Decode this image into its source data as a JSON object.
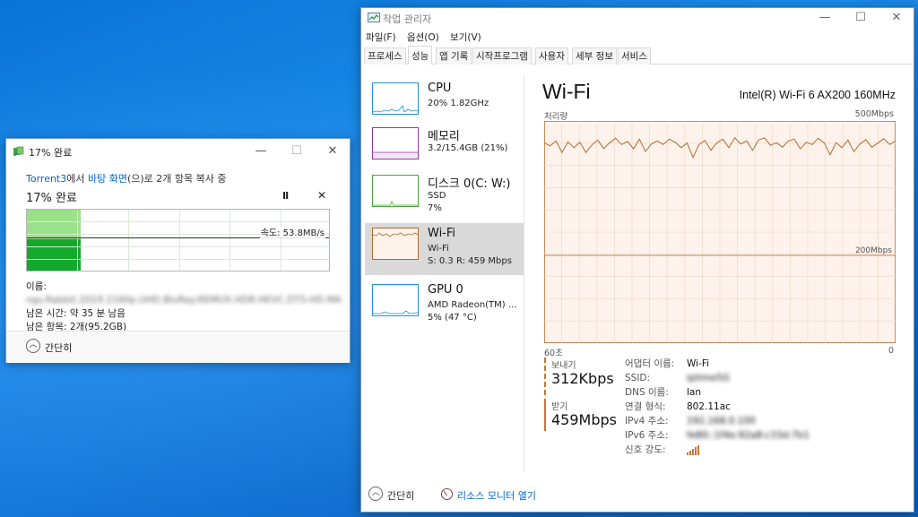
{
  "copy_dialog": {
    "title": "17% 완료",
    "source_name": "Torrent3",
    "source_mid": "에서",
    "dest_name": "바탕 화면",
    "source_tail": "(으)로 2개 항목 복사 중",
    "percent_label": "17% 완료",
    "pause_label": "II",
    "cancel_label": "✕",
    "progress_fraction": 0.17,
    "speed_label": "속도: 53.8MB/s",
    "name_label": "이름:",
    "name_value": "ngv.Rabbit.2019.2160p.UHD.BluRay.REMUX.HDR.HEVC.DTS-HD.MA",
    "time_left": "남은 시간: 약 35 분 남음",
    "items_left": "남은 항목: 2개(95.2GB)",
    "collapse_label": "간단히",
    "minimize": "—",
    "maximize": "☐",
    "close": "✕"
  },
  "task_manager": {
    "title": "작업 관리자",
    "minimize": "—",
    "maximize": "☐",
    "close": "✕",
    "menu": [
      "파일(F)",
      "옵션(O)",
      "보기(V)"
    ],
    "tabs": [
      "프로세스",
      "성능",
      "앱 기록",
      "시작프로그램",
      "사용자",
      "세부 정보",
      "서비스"
    ],
    "active_tab": 1,
    "sidebar": [
      {
        "name": "CPU",
        "line2": "20% 1.82GHz",
        "line3": "",
        "color": "#1f8fd8"
      },
      {
        "name": "메모리",
        "line2": "3.2/15.4GB (21%)",
        "line3": "",
        "color": "#8e3aa6"
      },
      {
        "name": "디스크 0(C: W:)",
        "line2": "SSD",
        "line3": "7%",
        "color": "#4aa33a"
      },
      {
        "name": "Wi-Fi",
        "line2": "Wi-Fi",
        "line3": "S: 0.3  R: 459 Mbps",
        "color": "#b1692a"
      },
      {
        "name": "GPU 0",
        "line2": "AMD Radeon(TM) ...",
        "line3": "5% (47 °C)",
        "color": "#1f8fd8"
      }
    ],
    "active_item": 3,
    "perf": {
      "title": "Wi-Fi",
      "device": "Intel(R) Wi-Fi 6 AX200 160MHz",
      "y_label": "처리량",
      "y_max_label": "500Mbps",
      "mid_label": "200Mbps",
      "x_left": "60초",
      "x_right": "0"
    },
    "send_label": "보내기",
    "send_value": "312Kbps",
    "recv_label": "받기",
    "recv_value": "459Mbps",
    "details": [
      {
        "k": "어댑터 이름:",
        "v": "Wi-Fi",
        "blur": false
      },
      {
        "k": "SSID:",
        "v": "iptime5G",
        "blur": true
      },
      {
        "k": "DNS 이름:",
        "v": "lan",
        "blur": false
      },
      {
        "k": "연결 형식:",
        "v": "802.11ac",
        "blur": false
      },
      {
        "k": "IPv4 주소:",
        "v": "192.168.0.100",
        "blur": true
      },
      {
        "k": "IPv6 주소:",
        "v": "fe80::1f4e:92a8:c33d:7b1",
        "blur": true
      },
      {
        "k": "신호 강도:",
        "v": "",
        "blur": false
      }
    ],
    "collapse_label": "간단히",
    "resmon_label": "리소스 모니터 열기"
  },
  "chart_data": {
    "type": "line",
    "title": "Wi-Fi",
    "ylabel": "처리량",
    "ylim": [
      0,
      500
    ],
    "y_unit": "Mbps",
    "x_range_seconds": [
      60,
      0
    ],
    "series": [
      {
        "name": "받기",
        "values": [
          451,
          444,
          455,
          429,
          453,
          440,
          452,
          429,
          446,
          457,
          438,
          451,
          461,
          447,
          454,
          437,
          459,
          431,
          448,
          455,
          447,
          459,
          452,
          440,
          450,
          418,
          447,
          456,
          434,
          451,
          459,
          440,
          462,
          448,
          455,
          434,
          457,
          462,
          445,
          451,
          441,
          455,
          459,
          437,
          452,
          447,
          461,
          451,
          424,
          451,
          440,
          457,
          431,
          448,
          458,
          441,
          450,
          460,
          447,
          455
        ]
      },
      {
        "name": "보내기",
        "values": [
          0.3,
          0.3,
          0.3,
          0.3,
          0.3,
          0.3,
          0.3,
          0.3,
          0.3,
          0.3,
          0.3,
          0.3,
          0.3,
          0.3,
          0.3,
          0.3,
          0.3,
          0.3,
          0.3,
          0.3,
          0.3,
          0.3,
          0.3,
          0.3,
          0.3,
          0.3,
          0.3,
          0.3,
          0.3,
          0.3,
          0.3,
          0.3,
          0.3,
          0.3,
          0.3,
          0.3,
          0.3,
          0.3,
          0.3,
          0.3,
          0.3,
          0.3,
          0.3,
          0.3,
          0.3,
          0.3,
          0.3,
          0.3,
          0.3,
          0.3,
          0.3,
          0.3,
          0.3,
          0.3,
          0.3,
          0.3,
          0.3,
          0.3,
          0.3,
          0.3
        ]
      }
    ],
    "grid": true
  }
}
